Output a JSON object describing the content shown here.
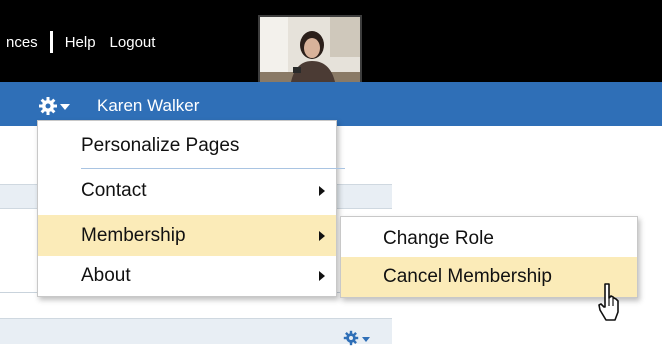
{
  "header": {
    "links": [
      "nces",
      "Help",
      "Logout"
    ]
  },
  "user": {
    "name": "Karen Walker",
    "icon": "gear-icon"
  },
  "menu": {
    "items": [
      {
        "label": "Personalize Pages",
        "has_submenu": false
      },
      {
        "label": "Contact",
        "has_submenu": true
      },
      {
        "label": "Membership",
        "has_submenu": true,
        "active": true
      },
      {
        "label": "About",
        "has_submenu": true
      }
    ]
  },
  "submenu": {
    "items": [
      {
        "label": "Change Role"
      },
      {
        "label": "Cancel Membership",
        "hovered": true
      }
    ]
  },
  "colors": {
    "topbar": "#000000",
    "bluebar": "#2f6fb7",
    "highlight": "#fbebb8"
  }
}
